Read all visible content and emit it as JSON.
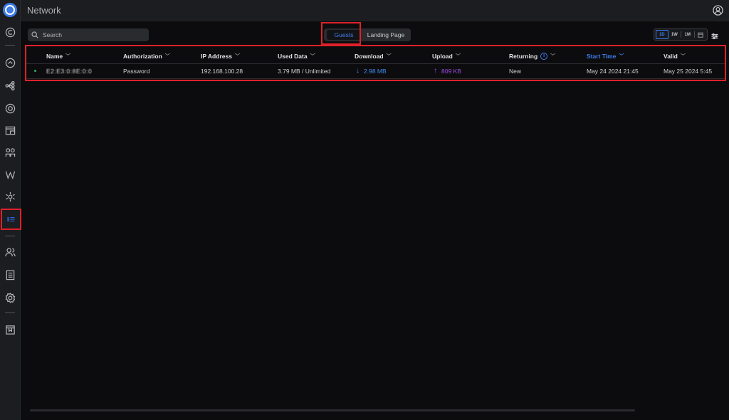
{
  "app": {
    "title": "Network"
  },
  "sidebar": {
    "active_label": "Ⅱ☰",
    "items": [
      "dashboard-icon",
      "topology-icon",
      "devices-icon",
      "clients-icon",
      "statistics-icon",
      "insights-icon",
      "vpn-icon",
      "settings-icon",
      "hotspot-icon",
      "users-icon",
      "logs-icon",
      "system-settings-icon",
      "release-notes-icon"
    ]
  },
  "toolbar": {
    "search_placeholder": "Search",
    "tabs": {
      "guests": "Guests",
      "landing": "Landing Page"
    },
    "range": {
      "d": "1D",
      "w": "1W",
      "m": "1M"
    }
  },
  "table": {
    "headers": {
      "name": "Name",
      "authorization": "Authorization",
      "ip": "IP Address",
      "used": "Used Data",
      "download": "Download",
      "upload": "Upload",
      "returning": "Returning",
      "start": "Start Time",
      "valid": "Valid"
    },
    "rows": [
      {
        "name": "E2:E3:0:8E:0:0",
        "authorization": "Password",
        "ip": "192.168.100.28",
        "used": "3.79 MB / Unlimited",
        "download": "2.98 MB",
        "upload": "809 KB",
        "returning": "New",
        "start": "May 24 2024 21:45",
        "valid": "May 25 2024 5:45"
      }
    ]
  },
  "colors": {
    "accent": "#3f7ef0",
    "highlight": "#e0202a",
    "upload": "#a04ce6",
    "download": "#3f8ff0"
  }
}
